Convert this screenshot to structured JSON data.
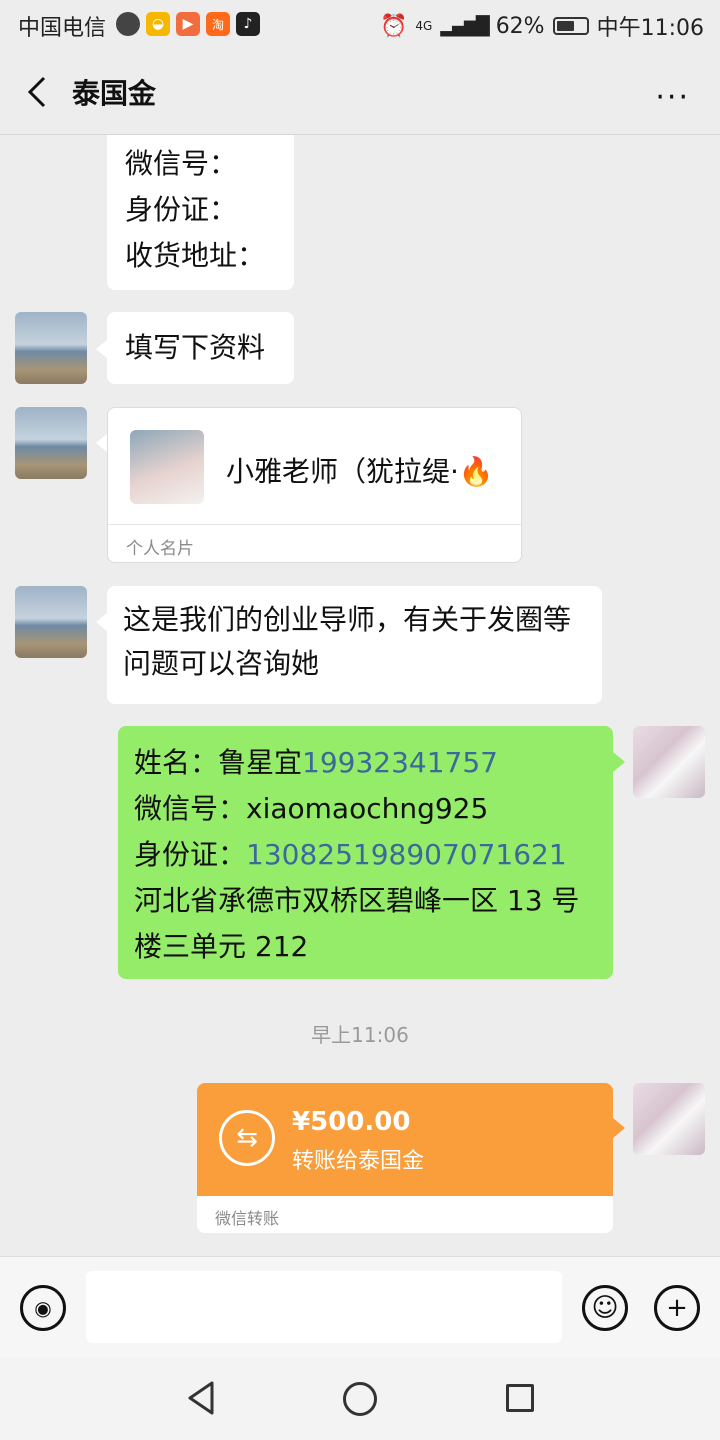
{
  "status_bar": {
    "carrier": "中国电信",
    "network": "4G",
    "battery": "62%",
    "battery_level": 0.62,
    "time": "中午11:06"
  },
  "header": {
    "title": "泰国金",
    "more_label": "···"
  },
  "messages": [
    {
      "lines": [
        "微信号：",
        "身份证：",
        "收货地址："
      ]
    },
    {
      "text": "填写下资料"
    },
    {
      "card": {
        "name": "小雅老师（犹拉缇·",
        "type": "个人名片"
      }
    },
    {
      "text": "这是我们的创业导师，有关于发圈等问题可以咨询她"
    },
    {
      "own": {
        "name_label": "姓名：鲁星宜",
        "phone": "19932341757",
        "wechat": "微信号：xiaomaochng925",
        "id_label": "身份证：",
        "id_number": "130825198907071621",
        "address": "河北省承德市双桥区碧峰一区 13 号楼三单元 212"
      }
    }
  ],
  "timestamp": "早上11:06",
  "transfer": {
    "amount": "¥500.00",
    "description": "转账给泰国金",
    "label": "微信转账"
  },
  "input_bar": {
    "text_value": ""
  }
}
